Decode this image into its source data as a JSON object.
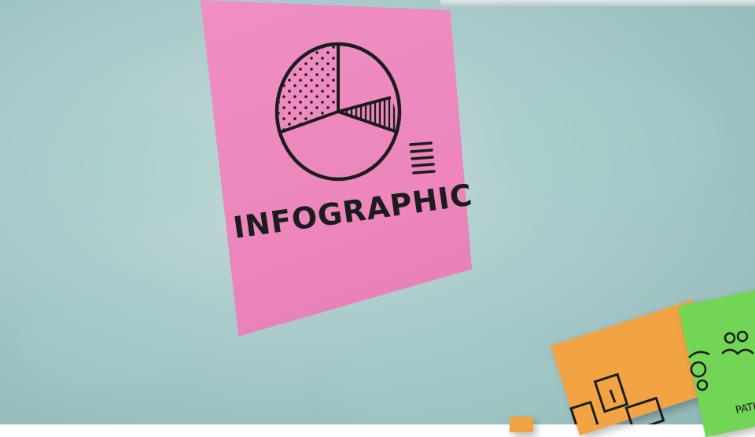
{
  "scene": {
    "board_color": "#aacbcb",
    "note_colors": {
      "pink": "#ec86bd",
      "orange": "#f2a444",
      "green": "#72d555"
    },
    "ink_color": "#1c1c1c"
  },
  "pink_note": {
    "label": "INFOGRAPHIC",
    "drawing_icon": "pie-chart-sketch-icon",
    "legend_icon": "legend-lines-icon"
  },
  "green_note": {
    "partial_label": "PATH",
    "drawing_icon": "people-sketch-icon"
  },
  "orange_note": {
    "drawing_icon": "boxes-sketch-icon"
  }
}
